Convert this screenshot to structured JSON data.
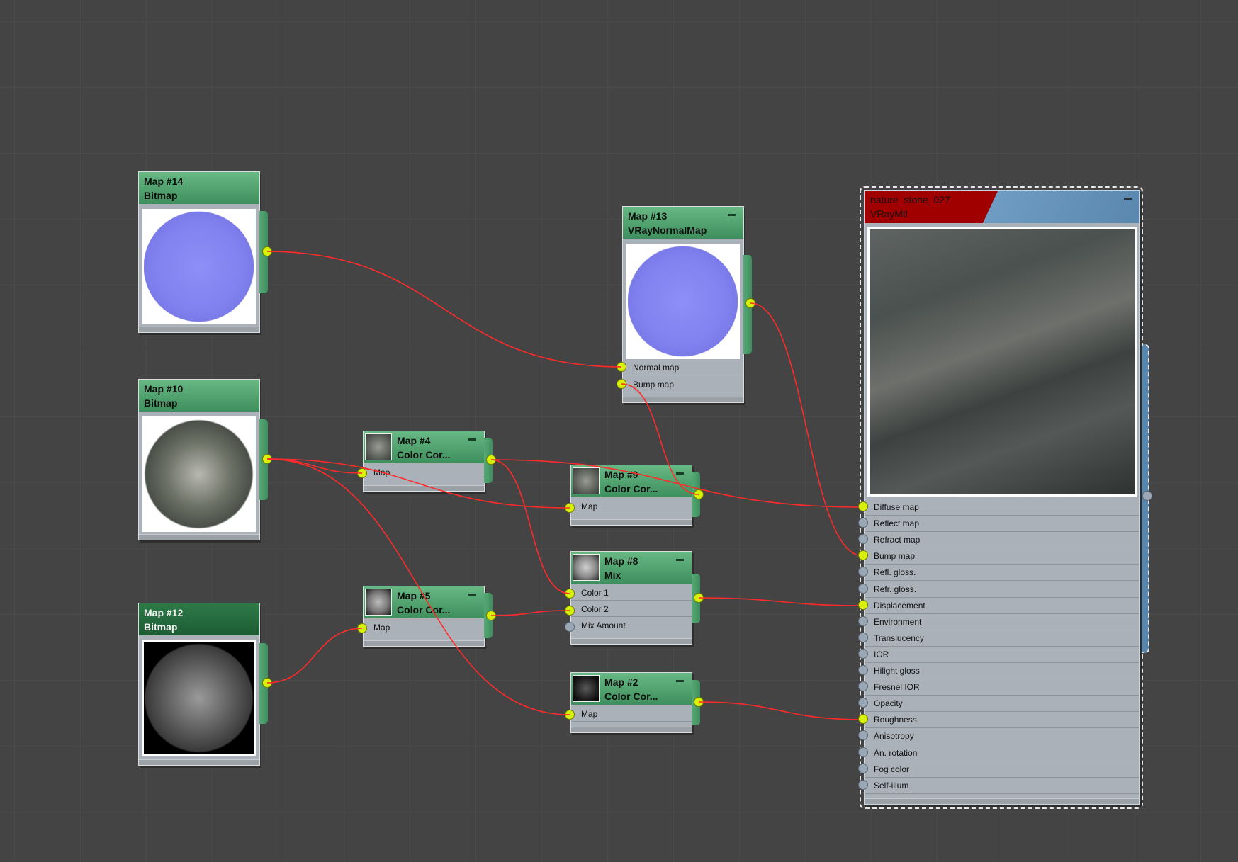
{
  "nodes": {
    "map14": {
      "title": "Map #14",
      "type": "Bitmap"
    },
    "map10": {
      "title": "Map #10",
      "type": "Bitmap"
    },
    "map12": {
      "title": "Map #12",
      "type": "Bitmap"
    },
    "map13": {
      "title": "Map #13",
      "type": "VRayNormalMap",
      "slots": [
        "Normal map",
        "Bump map"
      ]
    },
    "map4": {
      "title": "Map #4",
      "type": "Color Cor...",
      "slots": [
        "Map"
      ]
    },
    "map9": {
      "title": "Map #9",
      "type": "Color Cor...",
      "slots": [
        "Map"
      ]
    },
    "map5": {
      "title": "Map #5",
      "type": "Color Cor...",
      "slots": [
        "Map"
      ]
    },
    "map8": {
      "title": "Map #8",
      "type": "Mix",
      "slots": [
        "Color 1",
        "Color 2",
        "Mix Amount"
      ]
    },
    "map2": {
      "title": "Map #2",
      "type": "Color Cor...",
      "slots": [
        "Map"
      ]
    }
  },
  "material": {
    "name": "nature_stone_027",
    "type": "VRayMtl",
    "slots": [
      "Diffuse map",
      "Reflect map",
      "Refract map",
      "Bump map",
      "Refl. gloss.",
      "Refr. gloss.",
      "Displacement",
      "Environment",
      "Translucency",
      "IOR",
      "Hilight gloss",
      "Fresnel IOR",
      "Opacity",
      "Roughness",
      "Anisotropy",
      "An. rotation",
      "Fog color",
      "Self-illum"
    ],
    "connected_slots": [
      "Diffuse map",
      "Bump map",
      "Displacement",
      "Roughness"
    ]
  },
  "colors": {
    "background": "#444444",
    "node_header": "#4fa06d",
    "node_header_selected": "#25693c",
    "node_body": "#aab1b8",
    "wire": "#ff2a2a",
    "port_connected": "#d8f00c",
    "port_empty": "#9aa7b7",
    "material_header": "#a00000",
    "material_side_bar": "#5a86ac"
  },
  "icons": {
    "minimize": "minimize-icon",
    "connector_active": "connector-dot-icon",
    "connector_empty": "connector-empty-icon"
  }
}
